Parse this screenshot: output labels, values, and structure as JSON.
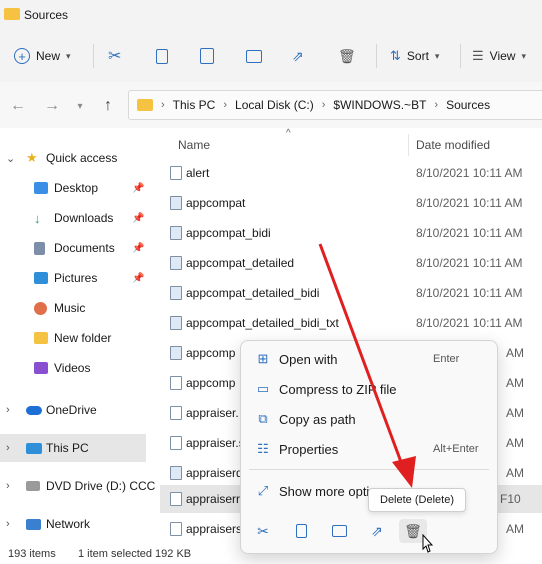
{
  "window": {
    "title": "Sources"
  },
  "toolbar": {
    "new_label": "New",
    "sort_label": "Sort",
    "view_label": "View"
  },
  "breadcrumb": [
    "This PC",
    "Local Disk (C:)",
    "$WINDOWS.~BT",
    "Sources"
  ],
  "sidebar": {
    "items": [
      {
        "label": "Quick access"
      },
      {
        "label": "Desktop"
      },
      {
        "label": "Downloads"
      },
      {
        "label": "Documents"
      },
      {
        "label": "Pictures"
      },
      {
        "label": "Music"
      },
      {
        "label": "New folder"
      },
      {
        "label": "Videos"
      },
      {
        "label": "OneDrive"
      },
      {
        "label": "This PC"
      },
      {
        "label": "DVD Drive (D:) CCC"
      },
      {
        "label": "Network"
      }
    ]
  },
  "columns": {
    "name": "Name",
    "date": "Date modified"
  },
  "files": [
    {
      "name": "alert",
      "date": "8/10/2021 10:11 AM"
    },
    {
      "name": "appcompat",
      "date": "8/10/2021 10:11 AM"
    },
    {
      "name": "appcompat_bidi",
      "date": "8/10/2021 10:11 AM"
    },
    {
      "name": "appcompat_detailed",
      "date": "8/10/2021 10:11 AM"
    },
    {
      "name": "appcompat_detailed_bidi",
      "date": "8/10/2021 10:11 AM"
    },
    {
      "name": "appcompat_detailed_bidi_txt",
      "date": "8/10/2021 10:11 AM"
    },
    {
      "name": "appcomp",
      "date": "AM"
    },
    {
      "name": "appcomp",
      "date": "AM"
    },
    {
      "name": "appraiser.",
      "date": "AM"
    },
    {
      "name": "appraiser.s",
      "date": "AM"
    },
    {
      "name": "appraiserd",
      "date": "AM"
    },
    {
      "name": "appraiserr",
      "date": "F10"
    },
    {
      "name": "appraisers",
      "date": "AM"
    }
  ],
  "context_menu": {
    "items": [
      {
        "label": "Open with",
        "shortcut": "Enter"
      },
      {
        "label": "Compress to ZIP file",
        "shortcut": ""
      },
      {
        "label": "Copy as path",
        "shortcut": ""
      },
      {
        "label": "Properties",
        "shortcut": "Alt+Enter"
      },
      {
        "label": "Show more opti",
        "shortcut": ""
      }
    ],
    "tooltip": "Delete (Delete)"
  },
  "status": {
    "count": "193 items",
    "selected": "1 item selected  192 KB"
  },
  "colors": {
    "accent": "#2f6fbf",
    "folder": "#f5c242",
    "annotation_arrow": "#e02020"
  }
}
